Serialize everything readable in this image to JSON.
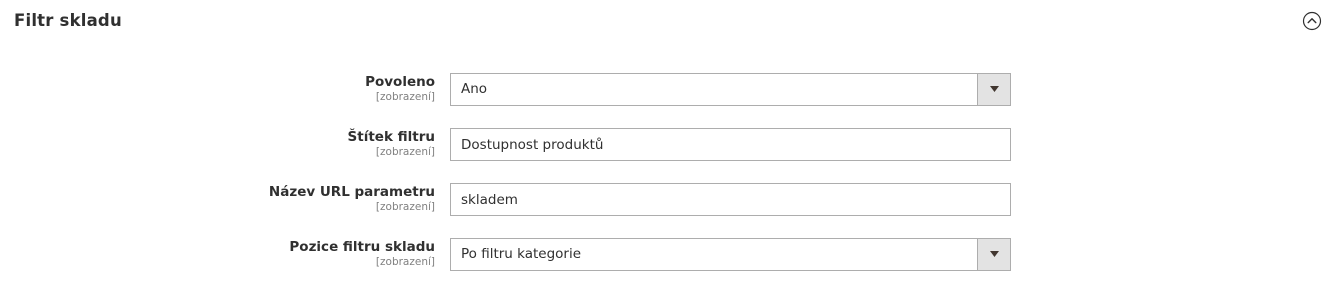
{
  "section": {
    "title": "Filtr skladu",
    "toggle_icon": "chevron-up-circle-icon"
  },
  "fields": [
    {
      "label": "Povoleno",
      "scope": "[zobrazení]",
      "type": "select",
      "value": "Ano"
    },
    {
      "label": "Štítek filtru",
      "scope": "[zobrazení]",
      "type": "text",
      "value": "Dostupnost produktů"
    },
    {
      "label": "Název URL parametru",
      "scope": "[zobrazení]",
      "type": "text",
      "value": "skladem"
    },
    {
      "label": "Pozice filtru skladu",
      "scope": "[zobrazení]",
      "type": "select",
      "value": "Po filtru kategorie"
    }
  ],
  "colors": {
    "border": "#adadad",
    "select_arrow_bg": "#e3e3e3",
    "text": "#303030",
    "scope_text": "#808080"
  }
}
